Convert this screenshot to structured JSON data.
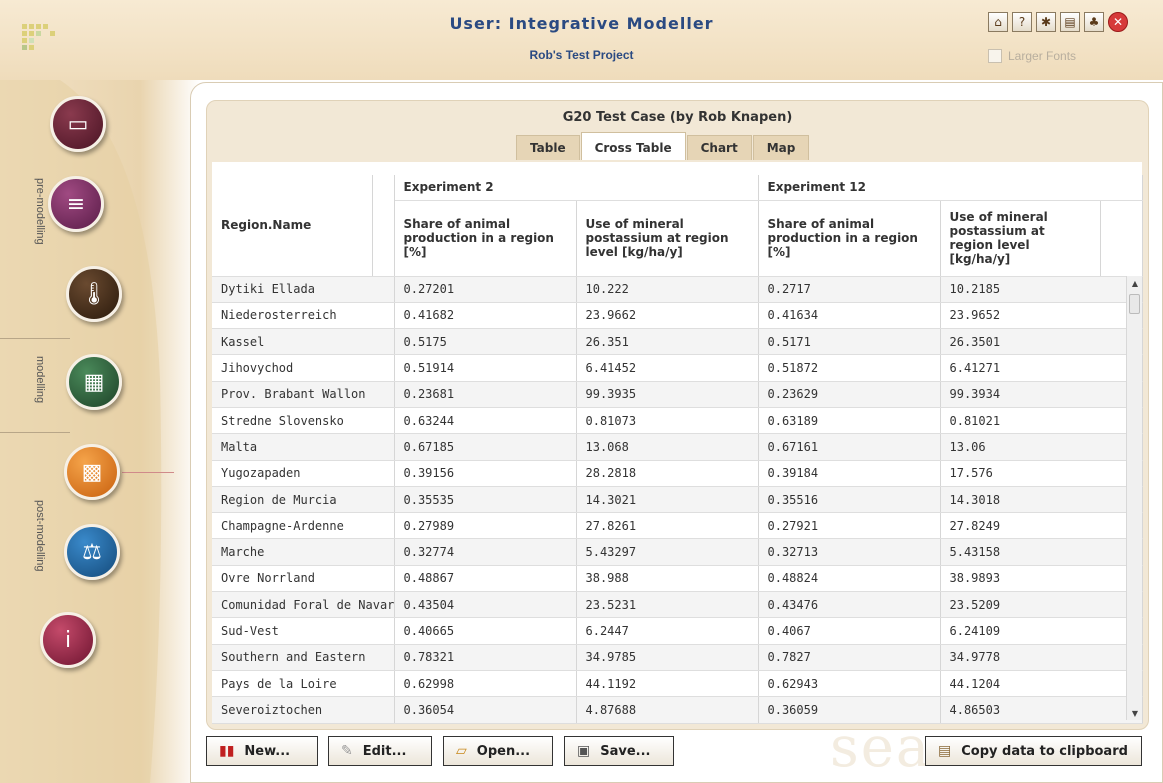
{
  "header": {
    "title": "User: Integrative Modeller",
    "project": "Rob's Test Project",
    "larger_fonts_label": "Larger Fonts",
    "icons": [
      "home-icon",
      "help-icon",
      "bug-icon",
      "book-icon",
      "users-icon",
      "close-icon"
    ]
  },
  "sidebar": {
    "sections": {
      "pre": "pre-modelling",
      "modelling": "modelling",
      "post": "post-modelling"
    },
    "items": [
      {
        "name": "clipboard-icon",
        "color": "#5a1f2e",
        "glyph": "📋"
      },
      {
        "name": "books-icon",
        "color": "#6b2c55",
        "glyph": "📚"
      },
      {
        "name": "thermometer-icon",
        "color": "#3e2a18",
        "glyph": "🌡"
      },
      {
        "name": "calculator-icon",
        "color": "#2f5a3a",
        "glyph": "🖩"
      },
      {
        "name": "chart-icon",
        "color": "#e07a1f",
        "glyph": "📈"
      },
      {
        "name": "scales-icon",
        "color": "#1f5a8a",
        "glyph": "⚖"
      },
      {
        "name": "info-icon",
        "color": "#8a1f3c",
        "glyph": "i"
      }
    ]
  },
  "case": {
    "title": "G20 Test Case (by Rob Knapen)",
    "tabs": [
      "Table",
      "Cross Table",
      "Chart",
      "Map"
    ],
    "active_tab": "Cross Table"
  },
  "table": {
    "region_header": "Region.Name",
    "experiments": [
      "Experiment 2",
      "Experiment 12"
    ],
    "indicator_1": "Share of animal production in a region [%]",
    "indicator_2": "Use of mineral postassium at region level [kg/ha/y]",
    "rows": [
      [
        "Dytiki Ellada",
        "0.27201",
        "10.222",
        "0.2717",
        "10.2185"
      ],
      [
        "Niederosterreich",
        "0.41682",
        "23.9662",
        "0.41634",
        "23.9652"
      ],
      [
        "Kassel",
        "0.5175",
        "26.351",
        "0.5171",
        "26.3501"
      ],
      [
        "Jihovychod",
        "0.51914",
        "6.41452",
        "0.51872",
        "6.41271"
      ],
      [
        "Prov. Brabant Wallon",
        "0.23681",
        "99.3935",
        "0.23629",
        "99.3934"
      ],
      [
        "Stredne Slovensko",
        "0.63244",
        "0.81073",
        "0.63189",
        "0.81021"
      ],
      [
        "Malta",
        "0.67185",
        "13.068",
        "0.67161",
        "13.06"
      ],
      [
        "Yugozapaden",
        "0.39156",
        "28.2818",
        "0.39184",
        "17.576"
      ],
      [
        "Region de Murcia",
        "0.35535",
        "14.3021",
        "0.35516",
        "14.3018"
      ],
      [
        "Champagne-Ardenne",
        "0.27989",
        "27.8261",
        "0.27921",
        "27.8249"
      ],
      [
        "Marche",
        "0.32774",
        "5.43297",
        "0.32713",
        "5.43158"
      ],
      [
        "Ovre Norrland",
        "0.48867",
        "38.988",
        "0.48824",
        "38.9893"
      ],
      [
        "Comunidad Foral de Navar",
        "0.43504",
        "23.5231",
        "0.43476",
        "23.5209"
      ],
      [
        "Sud-Vest",
        "0.40665",
        "6.2447",
        "0.4067",
        "6.24109"
      ],
      [
        "Southern and Eastern",
        "0.78321",
        "34.9785",
        "0.7827",
        "34.9778"
      ],
      [
        "Pays de la Loire",
        "0.62998",
        "44.1192",
        "0.62943",
        "44.1204"
      ],
      [
        "Severoiztochen",
        "0.36054",
        "4.87688",
        "0.36059",
        "4.86503"
      ]
    ]
  },
  "buttons": {
    "new": "New...",
    "edit": "Edit...",
    "open": "Open...",
    "save": "Save...",
    "copy": "Copy data to clipboard"
  },
  "watermark": "sea"
}
